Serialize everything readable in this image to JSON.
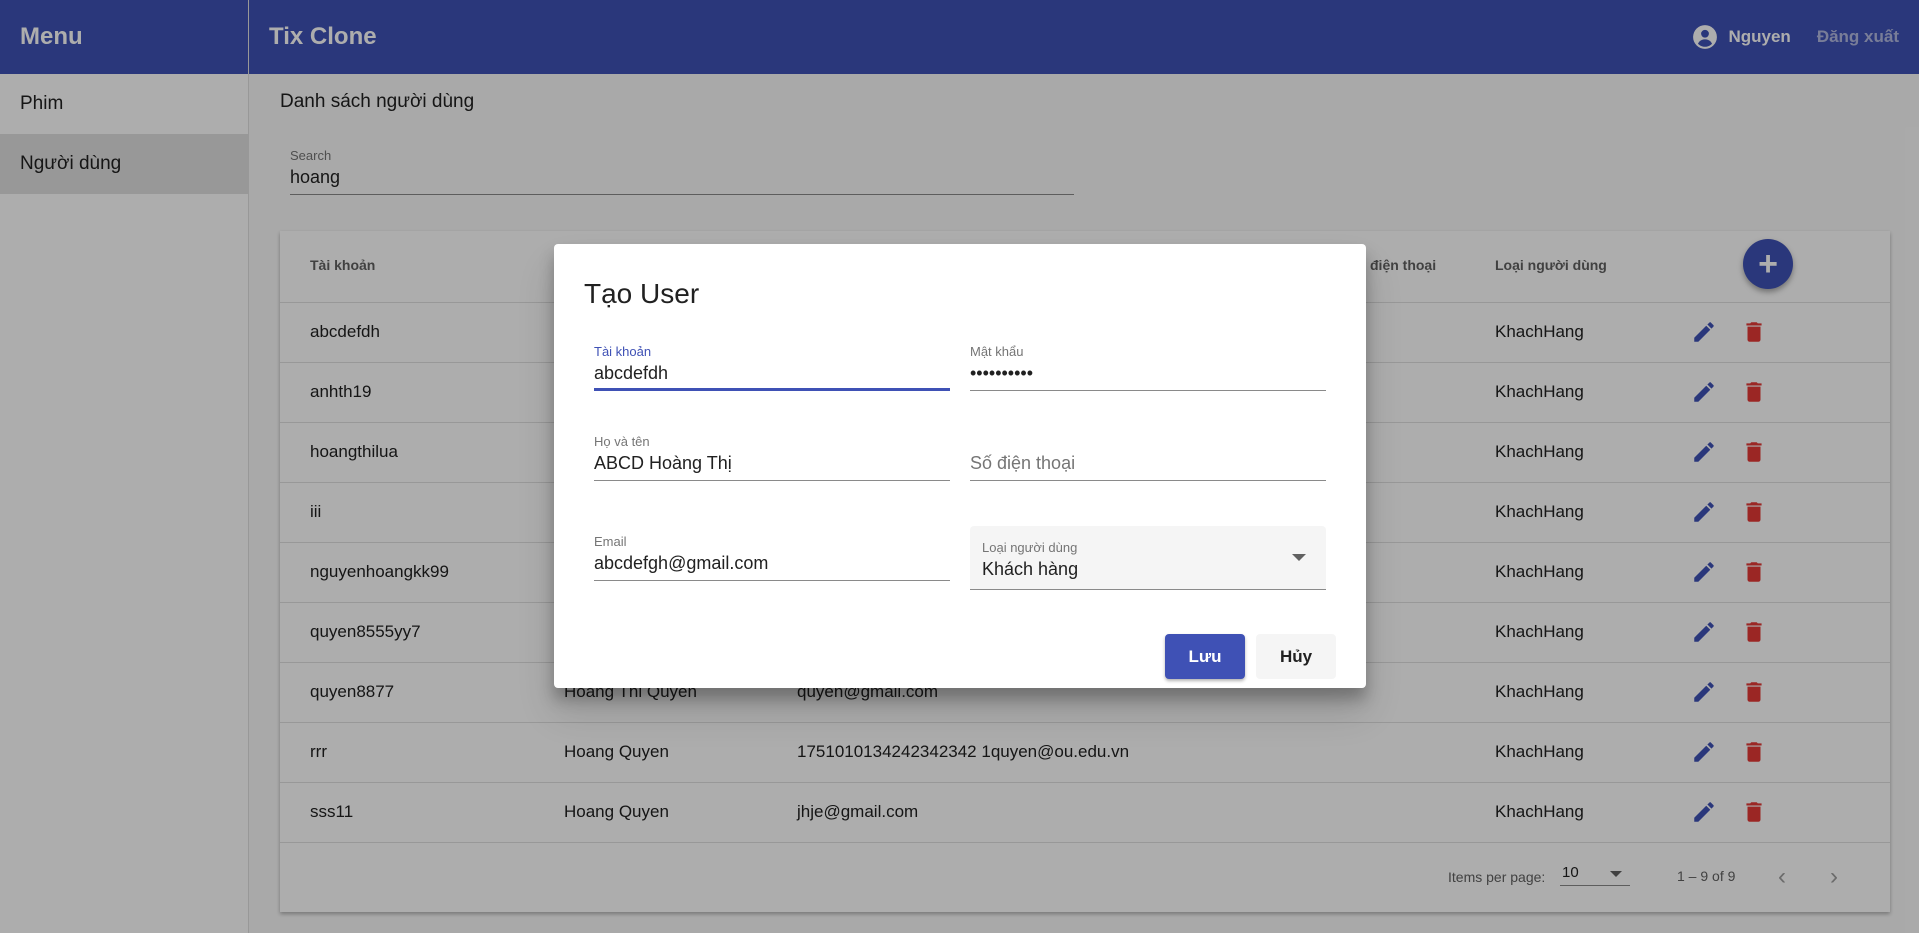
{
  "sidebar": {
    "title": "Menu",
    "items": [
      {
        "label": "Phim",
        "active": false
      },
      {
        "label": "Người dùng",
        "active": true
      }
    ]
  },
  "toolbar": {
    "app_title": "Tix Clone",
    "user_name": "Nguyen",
    "logout_label": "Đăng xuất",
    "color": "#3f51b5"
  },
  "page": {
    "title": "Danh sách người dùng",
    "search": {
      "label": "Search",
      "value": "hoang"
    }
  },
  "table": {
    "headers": {
      "account": "Tài khoản",
      "phone": "điện thoại",
      "user_type": "Loại người dùng"
    },
    "add_icon": "plus-icon",
    "rows": [
      {
        "account": "abcdefdh",
        "name": "",
        "email": "",
        "type": "KhachHang"
      },
      {
        "account": "anhth19",
        "name": "",
        "email": "",
        "type": "KhachHang"
      },
      {
        "account": "hoangthilua",
        "name": "",
        "email": "",
        "type": "KhachHang"
      },
      {
        "account": "iii",
        "name": "",
        "email": "",
        "type": "KhachHang"
      },
      {
        "account": "nguyenhoangkk99",
        "name": "",
        "email": "",
        "type": "KhachHang"
      },
      {
        "account": "quyen8555yy7",
        "name": "",
        "email": "",
        "type": "KhachHang"
      },
      {
        "account": "quyen8877",
        "name": "Hoang Thi Quyen",
        "email": "quyen@gmail.com",
        "type": "KhachHang"
      },
      {
        "account": "rrr",
        "name": "Hoang Quyen",
        "email": "1751010134242342342 1quyen@ou.edu.vn",
        "type": "KhachHang"
      },
      {
        "account": "sss11",
        "name": "Hoang Quyen",
        "email": "jhje@gmail.com",
        "type": "KhachHang"
      }
    ],
    "edit_color": "#3f51b5",
    "delete_color": "#e53935",
    "paginator": {
      "items_per_page_label": "Items per page:",
      "page_size": "10",
      "range": "1 – 9 of 9"
    }
  },
  "dialog": {
    "title": "Tạo User",
    "fields": {
      "account": {
        "label": "Tài khoản",
        "value": "abcdefdh"
      },
      "password": {
        "label": "Mật khẩu",
        "value": "••••••••••"
      },
      "full_name": {
        "label": "Họ và tên",
        "value": "ABCD Hoàng Thị"
      },
      "phone": {
        "placeholder": "Số điện thoại"
      },
      "email": {
        "label": "Email",
        "value": "abcdefgh@gmail.com"
      },
      "user_type": {
        "label": "Loại người dùng",
        "value": "Khách hàng"
      }
    },
    "save_label": "Lưu",
    "cancel_label": "Hủy"
  }
}
